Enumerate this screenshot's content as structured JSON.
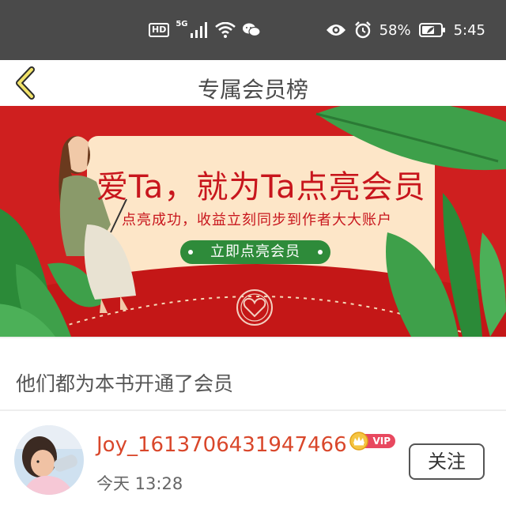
{
  "status_bar": {
    "hd": "HD",
    "network": "5G",
    "battery_percent": "58%",
    "time": "5:45"
  },
  "nav": {
    "title": "专属会员榜"
  },
  "banner": {
    "title": "爱Ta，就为Ta点亮会员",
    "subtitle": "点亮成功，收益立刻同步到作者大大账户",
    "button_label": "立即点亮会员"
  },
  "section": {
    "title": "他们都为本书开通了会员"
  },
  "members": [
    {
      "username": "Joy_1613706431947466",
      "badge": "VIP",
      "time": "今天 13:28",
      "follow_label": "关注"
    }
  ],
  "colors": {
    "status_bar_bg": "#4a4a4a",
    "banner_red": "#cf1f1f",
    "banner_cream": "#fde6c8",
    "username": "#d9472b",
    "button_green": "#2e8b3a"
  }
}
